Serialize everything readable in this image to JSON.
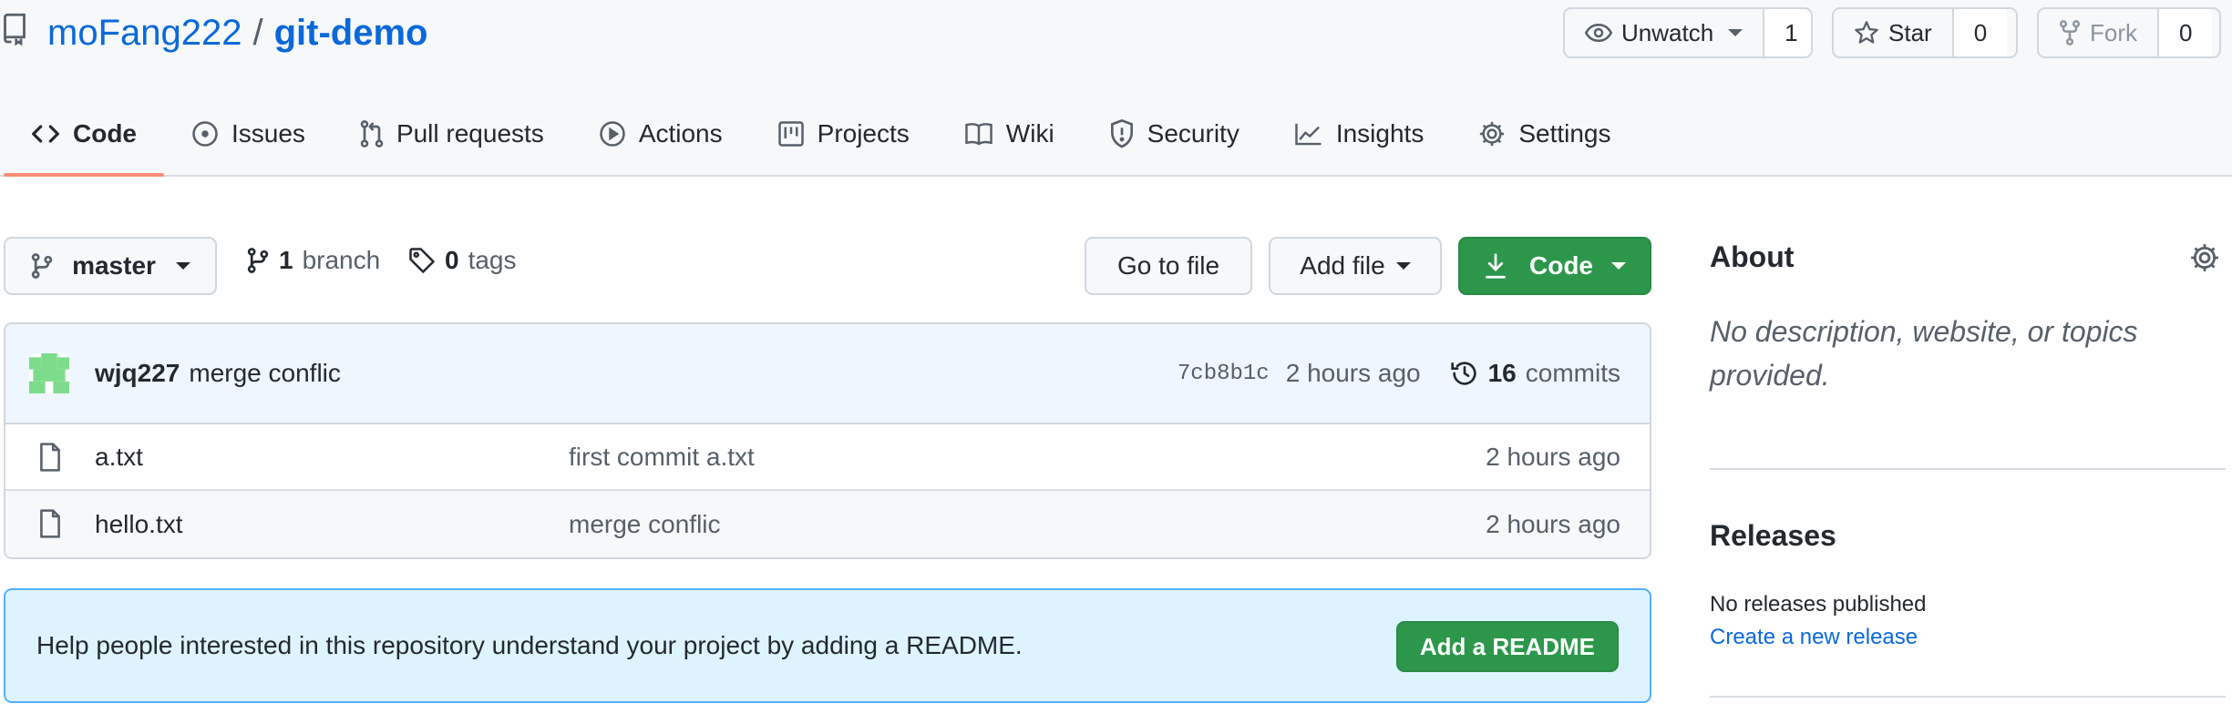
{
  "repo": {
    "owner": "moFang222",
    "separator": "/",
    "name": "git-demo"
  },
  "actions": {
    "watch": {
      "label": "Unwatch",
      "count": "1"
    },
    "star": {
      "label": "Star",
      "count": "0"
    },
    "fork": {
      "label": "Fork",
      "count": "0"
    }
  },
  "tabs": [
    {
      "label": "Code",
      "icon": "code-icon",
      "active": true
    },
    {
      "label": "Issues",
      "icon": "issue-icon"
    },
    {
      "label": "Pull requests",
      "icon": "pull-request-icon"
    },
    {
      "label": "Actions",
      "icon": "play-icon"
    },
    {
      "label": "Projects",
      "icon": "project-icon"
    },
    {
      "label": "Wiki",
      "icon": "book-icon"
    },
    {
      "label": "Security",
      "icon": "shield-icon"
    },
    {
      "label": "Insights",
      "icon": "graph-icon"
    },
    {
      "label": "Settings",
      "icon": "gear-icon"
    }
  ],
  "toolbar": {
    "branch": "master",
    "branch_count": "1",
    "branch_label": "branch",
    "tag_count": "0",
    "tag_label": "tags",
    "go_to_file": "Go to file",
    "add_file": "Add file",
    "code": "Code"
  },
  "commit": {
    "author": "wjq227",
    "message": "merge conflic",
    "sha": "7cb8b1c",
    "age": "2 hours ago",
    "commit_count": "16",
    "commit_label": "commits"
  },
  "files": [
    {
      "name": "a.txt",
      "commit": "first commit a.txt",
      "age": "2 hours ago"
    },
    {
      "name": "hello.txt",
      "commit": "merge conflic",
      "age": "2 hours ago"
    }
  ],
  "readme": {
    "text": "Help people interested in this repository understand your project by adding a README.",
    "button": "Add a README"
  },
  "about": {
    "title": "About",
    "description": "No description, website, or topics provided."
  },
  "releases": {
    "title": "Releases",
    "empty": "No releases published",
    "create_link": "Create a new release"
  },
  "colors": {
    "link": "#0969da",
    "primary_button": "#2c974b",
    "active_tab_underline": "#fd8c73",
    "readme_banner": "#ddf4ff"
  }
}
